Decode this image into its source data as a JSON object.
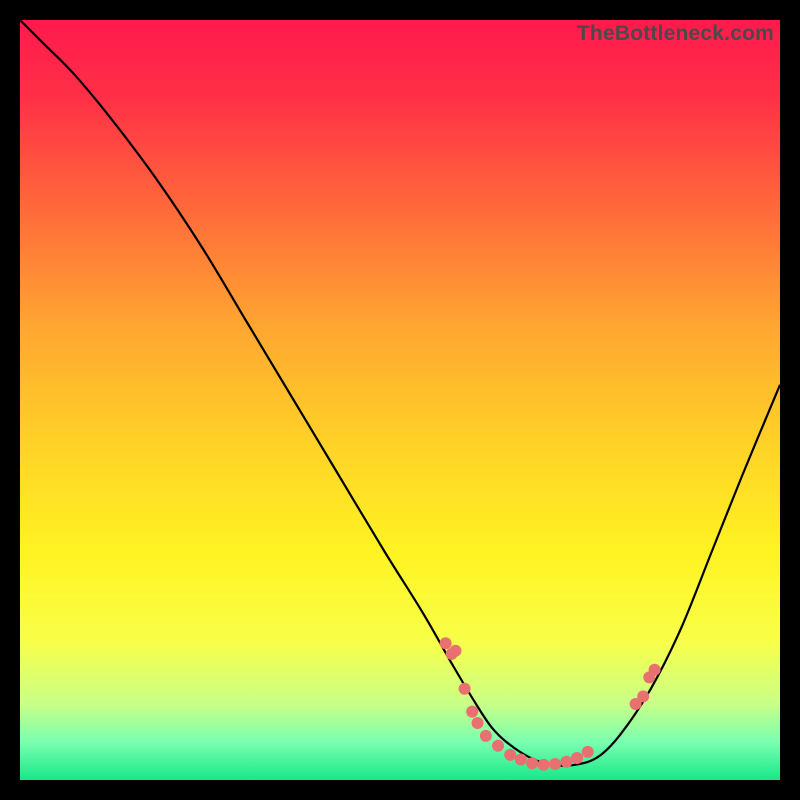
{
  "watermark": "TheBottleneck.com",
  "chart_data": {
    "type": "line",
    "title": "",
    "xlabel": "",
    "ylabel": "",
    "xlim": [
      0,
      100
    ],
    "ylim": [
      0,
      100
    ],
    "background_gradient": {
      "stops": [
        {
          "offset": 0.0,
          "color": "#ff1a4d"
        },
        {
          "offset": 0.1,
          "color": "#ff2f47"
        },
        {
          "offset": 0.25,
          "color": "#ff6a3a"
        },
        {
          "offset": 0.4,
          "color": "#ffa531"
        },
        {
          "offset": 0.55,
          "color": "#ffd028"
        },
        {
          "offset": 0.7,
          "color": "#fff322"
        },
        {
          "offset": 0.82,
          "color": "#f8ff4a"
        },
        {
          "offset": 0.9,
          "color": "#c8ff88"
        },
        {
          "offset": 0.95,
          "color": "#7affb0"
        },
        {
          "offset": 1.0,
          "color": "#17e88a"
        }
      ]
    },
    "series": [
      {
        "name": "bottleneck-curve",
        "color": "#000000",
        "x": [
          0,
          3,
          7,
          12,
          18,
          24,
          30,
          36,
          42,
          48,
          53,
          57,
          60,
          62,
          64,
          67,
          70,
          73,
          76,
          79,
          83,
          87,
          91,
          95,
          100
        ],
        "y": [
          100,
          97,
          93,
          87,
          79,
          70,
          60,
          50,
          40,
          30,
          22,
          15,
          10,
          7,
          5,
          3,
          2,
          2,
          3,
          6,
          12,
          20,
          30,
          40,
          52
        ]
      }
    ],
    "scatter": {
      "name": "dot-markers",
      "color": "#e97070",
      "radius": 6,
      "points": [
        {
          "x": 56.0,
          "y": 18.0
        },
        {
          "x": 56.8,
          "y": 16.6
        },
        {
          "x": 57.3,
          "y": 17.0
        },
        {
          "x": 58.5,
          "y": 12.0
        },
        {
          "x": 59.5,
          "y": 9.0
        },
        {
          "x": 60.2,
          "y": 7.5
        },
        {
          "x": 61.3,
          "y": 5.8
        },
        {
          "x": 62.9,
          "y": 4.5
        },
        {
          "x": 64.5,
          "y": 3.3
        },
        {
          "x": 65.9,
          "y": 2.7
        },
        {
          "x": 67.4,
          "y": 2.2
        },
        {
          "x": 68.9,
          "y": 2.0
        },
        {
          "x": 70.4,
          "y": 2.1
        },
        {
          "x": 71.9,
          "y": 2.4
        },
        {
          "x": 73.3,
          "y": 2.9
        },
        {
          "x": 74.7,
          "y": 3.7
        },
        {
          "x": 81.0,
          "y": 10.0
        },
        {
          "x": 82.0,
          "y": 11.0
        },
        {
          "x": 82.8,
          "y": 13.5
        },
        {
          "x": 83.5,
          "y": 14.5
        }
      ]
    }
  }
}
